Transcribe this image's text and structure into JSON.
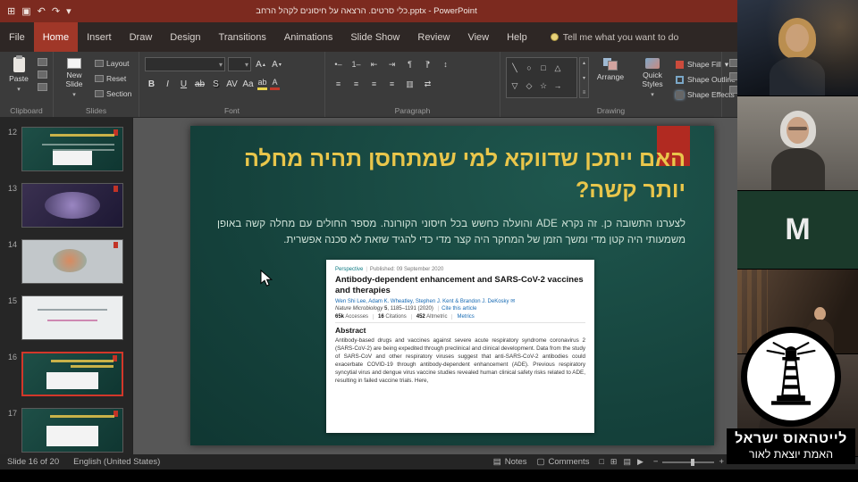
{
  "colors": {
    "titlebar_red": "#7c2a1f",
    "active_tab_red": "#a03728",
    "ribbon_gray": "#3b3b3b",
    "slide_teal": "#15423c",
    "accent_red": "#b12a21",
    "title_yellow": "#e9c64b"
  },
  "titlebar": {
    "title": "כלי סרטים. הרצאה על חיסונים לקהל הרחב.pptx - PowerPoint"
  },
  "tabs": {
    "items": [
      "File",
      "Home",
      "Insert",
      "Draw",
      "Design",
      "Transitions",
      "Animations",
      "Slide Show",
      "Review",
      "View",
      "Help"
    ],
    "tell_me": "Tell me what you want to do"
  },
  "glyphs": {
    "grid": "⊞",
    "save": "▣",
    "undo": "↶",
    "redo": "↷",
    "dropdown": "▾",
    "up": "▴",
    "bullets": "•–",
    "numbering": "1–",
    "indent_decrease": "⇤",
    "indent_increase": "⇥",
    "line_spacing": "↕",
    "pilcrow": "¶",
    "align": "≡",
    "columns": "▥",
    "text_direction": "⇄",
    "gallery_up": "▴",
    "gallery_down": "▾",
    "gallery_more": "≡",
    "notes": "▤",
    "comments": "▢",
    "view_normal": "□",
    "view_grid": "⊞",
    "view_read": "▤",
    "view_show": "▶",
    "zoom_out": "−",
    "zoom_in": "+"
  },
  "ribbon": {
    "clipboard": {
      "label": "Clipboard",
      "paste": "Paste"
    },
    "slides": {
      "label": "Slides",
      "new_slide": "New Slide",
      "layout": "Layout",
      "reset": "Reset",
      "section": "Section"
    },
    "font": {
      "label": "Font",
      "bold": "B",
      "italic": "I",
      "underline": "U",
      "strike": "ab",
      "shadow": "S",
      "spacing": "AV",
      "case": "Aa",
      "grow": "A",
      "highlight": "ab",
      "color": "A"
    },
    "paragraph": {
      "label": "Paragraph"
    },
    "shapes": [
      "╲",
      "○",
      "□",
      "△",
      "▽",
      "◇",
      "☆",
      "→"
    ],
    "drawing": {
      "label": "Drawing",
      "arrange": "Arrange",
      "quick_styles": "Quick Styles",
      "shape_fill": "Shape Fill",
      "shape_outline": "Shape Outline",
      "shape_effects": "Shape Effects"
    }
  },
  "slide_panel": {
    "slides": [
      {
        "number": "12"
      },
      {
        "number": "13"
      },
      {
        "number": "14"
      },
      {
        "number": "15"
      },
      {
        "number": "16"
      },
      {
        "number": "17"
      }
    ]
  },
  "slide": {
    "title": "האם ייתכן שדווקא למי שמתחסן תהיה מחלה יותר קשה?",
    "body": "לצערנו התשובה כן. זה נקרא ADE והועלה כחשש בכל חיסוני הקורונה. מספר החולים עם מחלה קשה באופן משמעותי היה קטן מדי ומשך הזמן של המחקר היה קצר מדי כדי להגיד שזאת לא סכנה אפשרית.",
    "article": {
      "type": "Perspective",
      "published": "Published: 09 September 2020",
      "title": "Antibody-dependent enhancement and SARS-CoV-2 vaccines and therapies",
      "authors": "Wen Shi Lee, Adam K. Wheatley, Stephen J. Kent & Brandon J. DeKosky ✉",
      "journal_name": "Nature Microbiology",
      "journal_volume": "5",
      "journal_pages": ", 1185–1191 (2020)",
      "cite": "Cite this article",
      "metrics": {
        "accesses_value": "65k",
        "accesses_label": "Accesses",
        "citations_value": "16",
        "citations_label": "Citations",
        "altmetric_value": "452",
        "altmetric_label": "Altmetric",
        "link": "Metrics"
      },
      "abstract_heading": "Abstract",
      "abstract_text": "Antibody-based drugs and vaccines against severe acute respiratory syndrome coronavirus 2 (SARS-CoV-2) are being expedited through preclinical and clinical development. Data from the study of SARS-CoV and other respiratory viruses suggest that anti-SARS-CoV-2 antibodies could exacerbate COVID-19 through antibody-dependent enhancement (ADE). Previous respiratory syncytial virus and dengue virus vaccine studies revealed human clinical safety risks related to ADE, resulting in failed vaccine trials. Here,"
    }
  },
  "status_bar": {
    "slide_indicator": "Slide 16 of 20",
    "language": "English (United States)",
    "notes": "Notes",
    "comments": "Comments"
  },
  "video_call": {
    "participant_initial": "M"
  },
  "watermark": {
    "title": "לייטהאוס ישראל",
    "subtitle": "האמת יוצאת לאור"
  }
}
